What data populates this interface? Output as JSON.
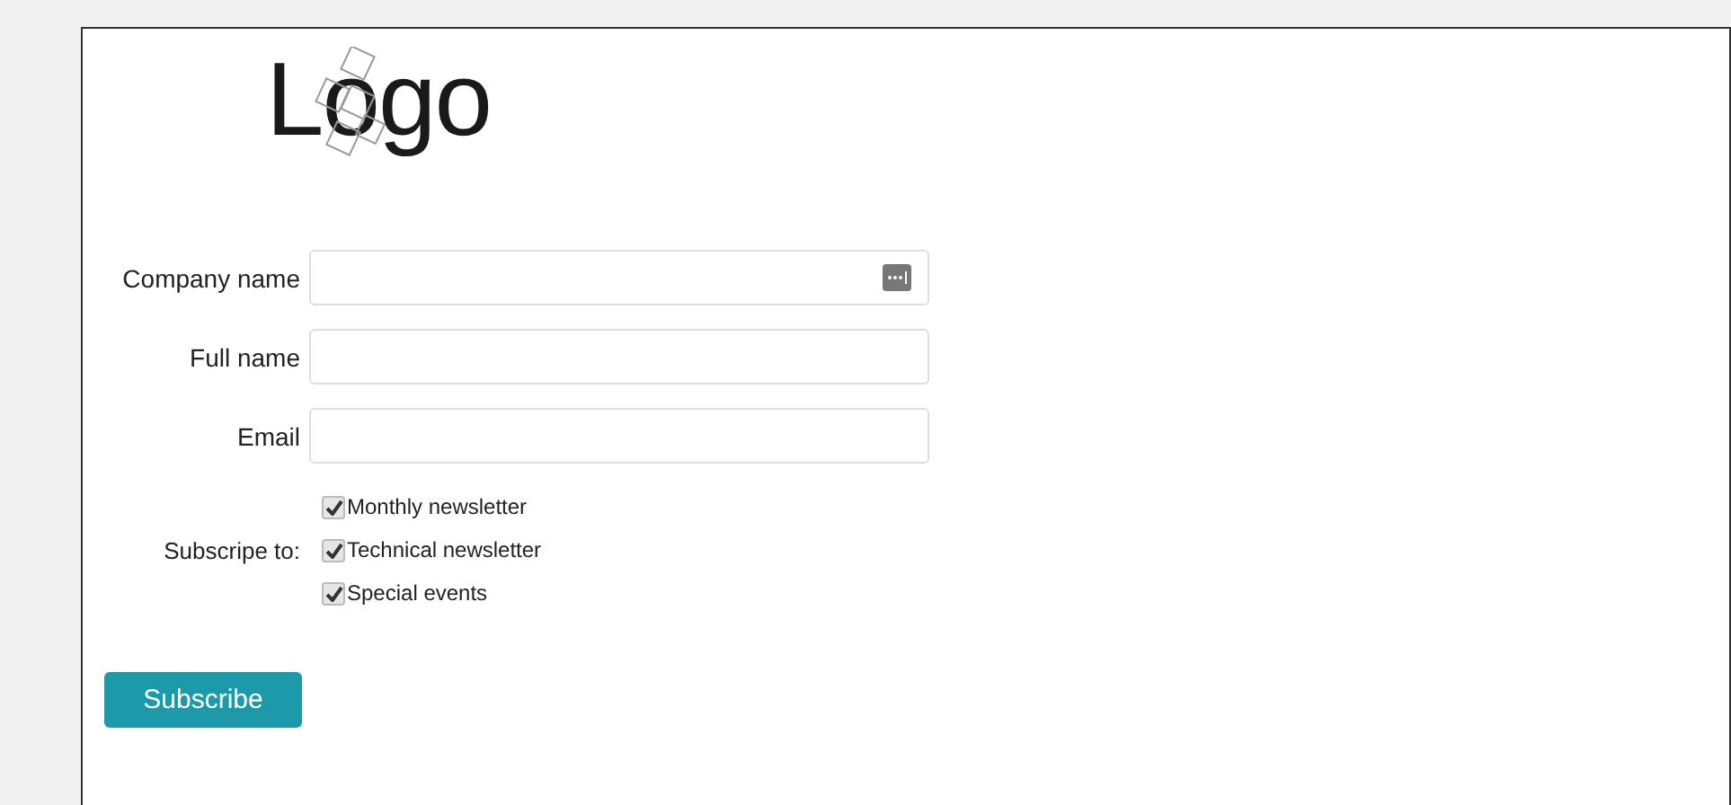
{
  "logo": {
    "text": "Logo"
  },
  "fields": [
    {
      "label": "Company name",
      "kind": "with-menu"
    },
    {
      "label": "Full name",
      "kind": "plain"
    },
    {
      "label": "Email",
      "kind": "plain"
    }
  ],
  "subscribe": {
    "label": "Subscripe to:",
    "options": [
      {
        "label": "Monthly newsletter",
        "checked": true
      },
      {
        "label": "Technical newsletter",
        "checked": true
      },
      {
        "label": "Special events",
        "checked": true
      }
    ]
  },
  "button": "Subscribe"
}
